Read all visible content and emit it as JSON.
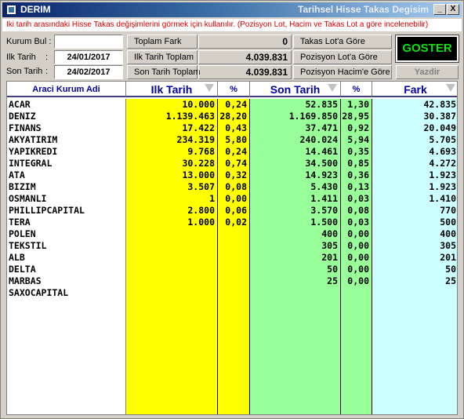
{
  "window": {
    "app_title": "DERIM",
    "form_title": "Tarihsel Hisse Takas Degisim",
    "minimize": "_",
    "close": "X"
  },
  "info": "Iki tarih arasındaki Hisse Takas değişimlerini görmek için kullanılır. (Pozisyon Lot, Hacim ve Takas Lot a göre incelenebilir)",
  "filters": {
    "kurum_label": "Kurum Bul :",
    "kurum_value": "",
    "ilk_label": "Ilk Tarih",
    "ilk_colon": ":",
    "ilk_value": "24/01/2017",
    "son_label": "Son Tarih",
    "son_colon": ":",
    "son_value": "24/02/2017"
  },
  "summary": {
    "toplam_fark_label": "Toplam Fark",
    "toplam_fark_value": "0",
    "ilk_toplam_label": "Ilk Tarih Toplam",
    "ilk_toplam_value": "4.039.831",
    "son_toplam_label": "Son Tarih Toplam",
    "son_toplam_value": "4.039.831"
  },
  "options": {
    "takas_lot": "Takas Lot'a Göre",
    "pozisyon_lot": "Pozisyon Lot'a Göre",
    "pozisyon_hacim": "Pozisyon Hacim'e Göre"
  },
  "buttons": {
    "goster": "GOSTER",
    "yazdir": "Yazdir"
  },
  "colors": {
    "yellow": "#ffff00",
    "green": "#99ff99",
    "cyan": "#ccffff",
    "goster_text": "#10e010",
    "info_text": "#e00000"
  },
  "table": {
    "headers": {
      "kurum": "Araci Kurum Adi",
      "ilk": "Ilk Tarih",
      "ilk_pct": "%",
      "son": "Son Tarih",
      "son_pct": "%",
      "fark": "Fark"
    },
    "rows": [
      {
        "name": "ACAR",
        "ilk": "10.000",
        "ilk_pct": "0,24",
        "son": "52.835",
        "son_pct": "1,30",
        "fark": "42.835"
      },
      {
        "name": "DENIZ",
        "ilk": "1.139.463",
        "ilk_pct": "28,20",
        "son": "1.169.850",
        "son_pct": "28,95",
        "fark": "30.387"
      },
      {
        "name": "FINANS",
        "ilk": "17.422",
        "ilk_pct": "0,43",
        "son": "37.471",
        "son_pct": "0,92",
        "fark": "20.049"
      },
      {
        "name": "AKYATIRIM",
        "ilk": "234.319",
        "ilk_pct": "5,80",
        "son": "240.024",
        "son_pct": "5,94",
        "fark": "5.705"
      },
      {
        "name": "YAPIKREDI",
        "ilk": "9.768",
        "ilk_pct": "0,24",
        "son": "14.461",
        "son_pct": "0,35",
        "fark": "4.693"
      },
      {
        "name": "INTEGRAL",
        "ilk": "30.228",
        "ilk_pct": "0,74",
        "son": "34.500",
        "son_pct": "0,85",
        "fark": "4.272"
      },
      {
        "name": "ATA",
        "ilk": "13.000",
        "ilk_pct": "0,32",
        "son": "14.923",
        "son_pct": "0,36",
        "fark": "1.923"
      },
      {
        "name": "BIZIM",
        "ilk": "3.507",
        "ilk_pct": "0,08",
        "son": "5.430",
        "son_pct": "0,13",
        "fark": "1.923"
      },
      {
        "name": "OSMANLI",
        "ilk": "1",
        "ilk_pct": "0,00",
        "son": "1.411",
        "son_pct": "0,03",
        "fark": "1.410"
      },
      {
        "name": "PHILLIPCAPITAL",
        "ilk": "2.800",
        "ilk_pct": "0,06",
        "son": "3.570",
        "son_pct": "0,08",
        "fark": "770"
      },
      {
        "name": "TERA",
        "ilk": "1.000",
        "ilk_pct": "0,02",
        "son": "1.500",
        "son_pct": "0,03",
        "fark": "500"
      },
      {
        "name": "POLEN",
        "ilk": "",
        "ilk_pct": "",
        "son": "400",
        "son_pct": "0,00",
        "fark": "400"
      },
      {
        "name": "TEKSTIL",
        "ilk": "",
        "ilk_pct": "",
        "son": "305",
        "son_pct": "0,00",
        "fark": "305"
      },
      {
        "name": "ALB",
        "ilk": "",
        "ilk_pct": "",
        "son": "201",
        "son_pct": "0,00",
        "fark": "201"
      },
      {
        "name": "DELTA",
        "ilk": "",
        "ilk_pct": "",
        "son": "50",
        "son_pct": "0,00",
        "fark": "50"
      },
      {
        "name": "MARBAS",
        "ilk": "",
        "ilk_pct": "",
        "son": "25",
        "son_pct": "0,00",
        "fark": "25"
      },
      {
        "name": "SAXOCAPITAL",
        "ilk": "",
        "ilk_pct": "",
        "son": "",
        "son_pct": "",
        "fark": ""
      }
    ]
  }
}
